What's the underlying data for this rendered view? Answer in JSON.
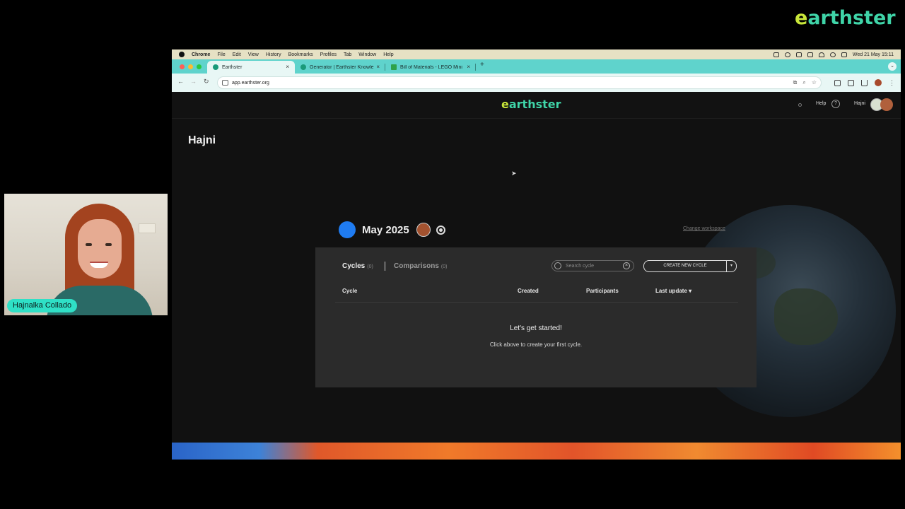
{
  "brand": {
    "logo_e": "e",
    "logo_rest": "arthster"
  },
  "webcam": {
    "name": "Hajnalka Collado"
  },
  "mac_menubar": {
    "items": [
      "Chrome",
      "File",
      "Edit",
      "View",
      "History",
      "Bookmarks",
      "Profiles",
      "Tab",
      "Window",
      "Help"
    ],
    "clock": "Wed 21 May 15:11",
    "status_icons": [
      "wifi-icon",
      "search-icon",
      "control-center-icon",
      "battery-icon",
      "keyboard-icon",
      "focus-icon",
      "moon-icon"
    ]
  },
  "tabs": [
    {
      "title": "Earthster",
      "favicon_color": "#1a9a7a"
    },
    {
      "title": "Generator | Earthster Knowle",
      "favicon_color": "#1a9a7a"
    },
    {
      "title": "Bill of Materials - LEGO Mini",
      "favicon_color": "#2fa24a"
    }
  ],
  "address_bar": {
    "url": "app.earthster.org"
  },
  "app": {
    "logo_e": "e",
    "logo_rest": "arthster",
    "help_label": "Help",
    "user_label": "Hajni",
    "page_title": "Hajni",
    "workspace": {
      "name": "May 2025",
      "change_label": "Change workspace",
      "color": "#1f7cf2"
    },
    "tabs": {
      "cycles": {
        "label": "Cycles",
        "count": "(0)"
      },
      "comparisons": {
        "label": "Comparisons",
        "count": "(0)"
      }
    },
    "search_placeholder": "Search cycle",
    "create_button": "CREATE NEW CYCLE",
    "columns": {
      "cycle": "Cycle",
      "created": "Created",
      "participants": "Participants",
      "last_update": "Last update ▾"
    },
    "empty_title": "Let's get started!",
    "empty_subtitle": "Click above to create your first cycle."
  }
}
